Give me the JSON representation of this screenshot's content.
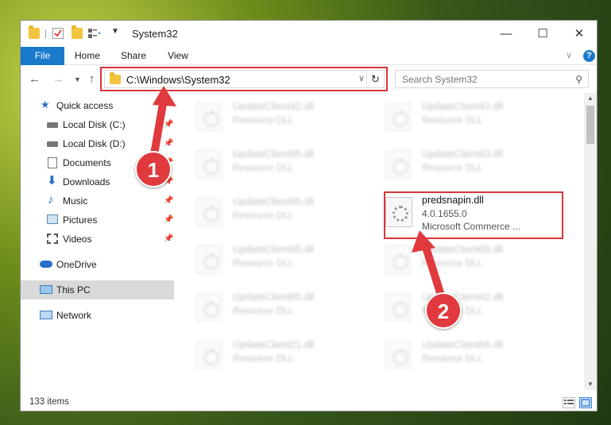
{
  "window": {
    "title": "System32",
    "controls": {
      "minimize": "—",
      "maximize": "☐",
      "close": "✕"
    }
  },
  "ribbon": {
    "tabs": [
      {
        "label": "File"
      },
      {
        "label": "Home"
      },
      {
        "label": "Share"
      },
      {
        "label": "View"
      }
    ],
    "help": "?"
  },
  "address_bar": {
    "path": "C:\\Windows\\System32",
    "search_placeholder": "Search System32"
  },
  "sidebar": {
    "items": [
      {
        "label": "Quick access",
        "icon": "star-icon",
        "pinned": false
      },
      {
        "label": "Local Disk (C:)",
        "icon": "drive-icon",
        "pinned": true
      },
      {
        "label": "Local Disk (D:)",
        "icon": "drive-icon",
        "pinned": true
      },
      {
        "label": "Documents",
        "icon": "documents-icon",
        "pinned": true
      },
      {
        "label": "Downloads",
        "icon": "download-icon",
        "pinned": true
      },
      {
        "label": "Music",
        "icon": "music-icon",
        "pinned": true
      },
      {
        "label": "Pictures",
        "icon": "pictures-icon",
        "pinned": true
      },
      {
        "label": "Videos",
        "icon": "videos-icon",
        "pinned": true
      },
      {
        "label": "OneDrive",
        "icon": "cloud-icon",
        "pinned": false
      },
      {
        "label": "This PC",
        "icon": "computer-icon",
        "pinned": false,
        "selected": true
      },
      {
        "label": "Network",
        "icon": "network-icon",
        "pinned": false
      }
    ]
  },
  "files": [
    {
      "name": "UpdateClient42.dll",
      "type": "Resource DLL"
    },
    {
      "name": "UpdateClient42.dll",
      "type": "Resource DLL"
    },
    {
      "name": "UpdateClient65.dll",
      "type": "Resource DLL"
    },
    {
      "name": "UpdateClient63.dll",
      "type": "Resource DLL"
    },
    {
      "name": "UpdateClient65.dll",
      "type": "Resource DLL"
    },
    {
      "name": "predsnapin.dll",
      "version": "4.0.1655.0",
      "company": "Microsoft Commerce ...",
      "highlighted": true
    },
    {
      "name": "UpdateClient65.dll",
      "type": "Resource DLL"
    },
    {
      "name": "UpdateClient65.dll",
      "type": "Resource DLL"
    },
    {
      "name": "UpdateClient65.dll",
      "type": "Resource DLL"
    },
    {
      "name": "UpdateClient42.dll",
      "type": "Resource DLL"
    },
    {
      "name": "UpdateClient21.dll",
      "type": "Resource DLL"
    },
    {
      "name": "UpdateClient65.dll",
      "type": "Resource DLL"
    }
  ],
  "status": {
    "item_count": "133 items"
  },
  "annotations": {
    "step1": "1",
    "step2": "2"
  },
  "colors": {
    "accent": "#1979ca",
    "highlight": "#d8353b",
    "badge": "#e0393e"
  }
}
